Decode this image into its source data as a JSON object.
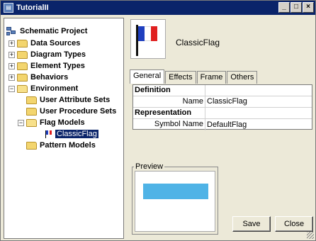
{
  "window": {
    "title": "TutorialII"
  },
  "tree": {
    "items": [
      {
        "label": "Schematic Project"
      },
      {
        "label": "Data Sources"
      },
      {
        "label": "Diagram Types"
      },
      {
        "label": "Element Types"
      },
      {
        "label": "Behaviors"
      },
      {
        "label": "Environment"
      },
      {
        "label": "User Attribute Sets"
      },
      {
        "label": "User Procedure Sets"
      },
      {
        "label": "Flag Models"
      },
      {
        "label": "ClassicFlag"
      },
      {
        "label": "Pattern Models"
      }
    ]
  },
  "header": {
    "name": "ClassicFlag"
  },
  "tabs": [
    {
      "label": "General"
    },
    {
      "label": "Effects"
    },
    {
      "label": "Frame"
    },
    {
      "label": "Others"
    }
  ],
  "properties": {
    "definition_label": "Definition",
    "name_key": "Name",
    "name_value": "ClassicFlag",
    "representation_label": "Representation",
    "symbol_key": "Symbol Name",
    "symbol_value": "DefaultFlag"
  },
  "preview": {
    "label": "Preview"
  },
  "buttons": {
    "save": "Save",
    "close": "Close"
  },
  "colors": {
    "flag_blue": "#1f3fbf",
    "flag_white": "#ffffff",
    "flag_red": "#e02020",
    "preview_fill": "#4fb3e6",
    "titlebar": "#0a246a"
  }
}
